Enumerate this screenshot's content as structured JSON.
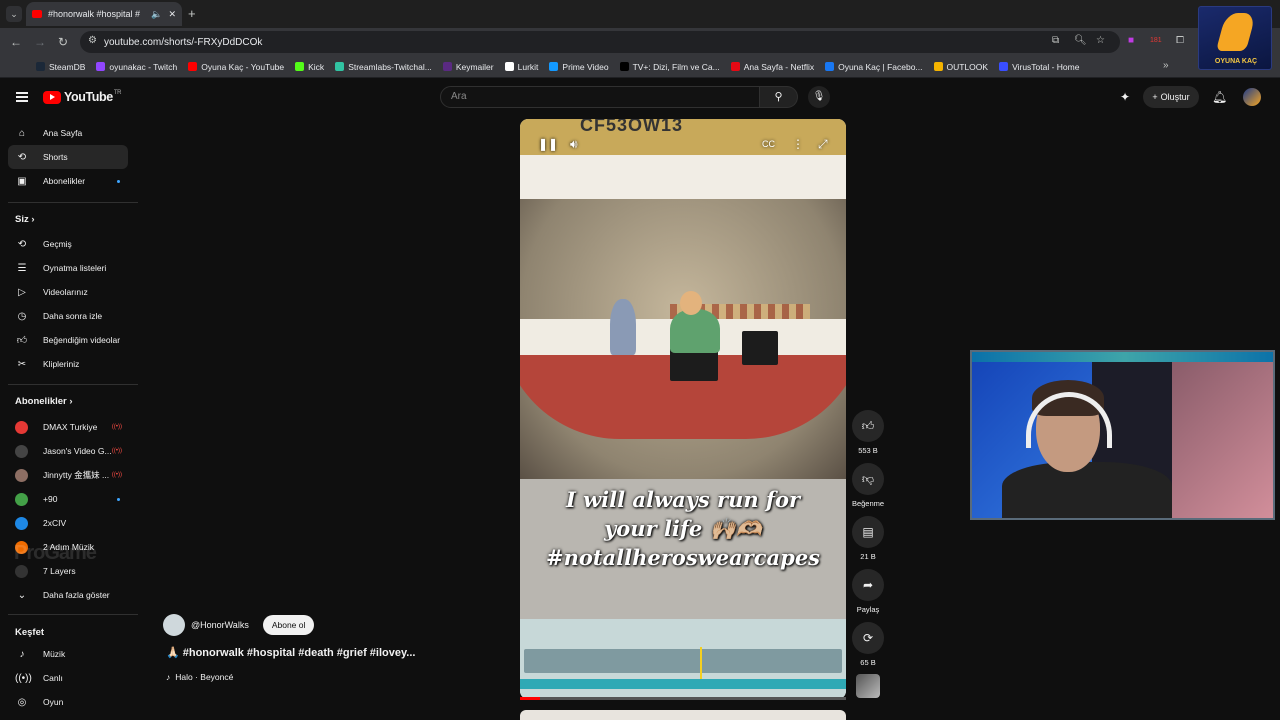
{
  "browser": {
    "tab_title": "#honorwalk #hospital #",
    "url": "youtube.com/shorts/-FRXyDdDCOk",
    "bookmarks": [
      {
        "label": "SteamDB",
        "color": "#1b2838"
      },
      {
        "label": "oyunakac - Twitch",
        "color": "#9146ff"
      },
      {
        "label": "Oyuna Kaç - YouTube",
        "color": "#ff0000"
      },
      {
        "label": "Kick",
        "color": "#53fc18"
      },
      {
        "label": "Streamlabs-Twitchal...",
        "color": "#31c3a2"
      },
      {
        "label": "Keymailer",
        "color": "#5a2a82"
      },
      {
        "label": "Lurkit",
        "color": "#ffffff"
      },
      {
        "label": "Prime Video",
        "color": "#1399ff"
      },
      {
        "label": "TV+: Dizi, Film ve Ca...",
        "color": "#000000"
      },
      {
        "label": "Ana Sayfa - Netflix",
        "color": "#e50914"
      },
      {
        "label": "Oyuna Kaç | Facebo...",
        "color": "#1877f2"
      },
      {
        "label": "OUTLOOK",
        "color": "#f5b400"
      },
      {
        "label": "VirusTotal - Home",
        "color": "#394eff"
      }
    ],
    "badge_text": "181"
  },
  "youtube": {
    "logo": "YouTube",
    "region": "TR",
    "search_placeholder": "Ara",
    "create_label": "Oluştur",
    "sidebar": {
      "main": [
        {
          "label": "Ana Sayfa",
          "icon": "home-icon"
        },
        {
          "label": "Shorts",
          "icon": "shorts-icon"
        },
        {
          "label": "Abonelikler",
          "icon": "subscriptions-icon"
        }
      ],
      "you_header": "Siz",
      "you": [
        {
          "label": "Geçmiş",
          "icon": "history-icon"
        },
        {
          "label": "Oynatma listeleri",
          "icon": "playlist-icon"
        },
        {
          "label": "Videolarınız",
          "icon": "your-videos-icon"
        },
        {
          "label": "Daha sonra izle",
          "icon": "watch-later-icon"
        },
        {
          "label": "Beğendiğim videolar",
          "icon": "liked-icon"
        },
        {
          "label": "Klipleriniz",
          "icon": "clips-icon"
        }
      ],
      "subs_header": "Abonelikler",
      "subs": [
        {
          "label": "DMAX Turkiye",
          "color": "#e53935"
        },
        {
          "label": "Jason's Video G...",
          "color": "#444444"
        },
        {
          "label": "Jinnytty 金攜妹 ...",
          "color": "#8d6e63"
        },
        {
          "label": "+90",
          "color": "#43a047"
        },
        {
          "label": "2xCIV",
          "color": "#1e88e5"
        },
        {
          "label": "2 Adım Müzik",
          "color": "#ef6c00"
        },
        {
          "label": "7 Layers",
          "color": "#333333"
        }
      ],
      "show_more": "Daha fazla göster",
      "explore_header": "Keşfet",
      "explore": [
        {
          "label": "Müzik",
          "icon": "music-icon"
        },
        {
          "label": "Canlı",
          "icon": "live-icon"
        },
        {
          "label": "Oyun",
          "icon": "gaming-icon"
        }
      ]
    },
    "short": {
      "overlay_text_line1": "I will always run for",
      "overlay_text_line2": "your life 🙌🏼🫶🏼",
      "overlay_text_line3": "#notallheroswearcapes",
      "top_code": "CF53OW13",
      "channel": "@HonorWalks",
      "subscribe_label": "Abone ol",
      "title": "🙏🏻 #honorwalk #hospital #death #grief #ilovey...",
      "music": "Halo · Beyoncé",
      "progress": 0.06
    },
    "actions": {
      "like_count": "553 B",
      "dislike_label": "Beğenme",
      "comment_count": "21 B",
      "share_label": "Paylaş",
      "remix_count": "65 B"
    },
    "watermark": "ProGame"
  }
}
